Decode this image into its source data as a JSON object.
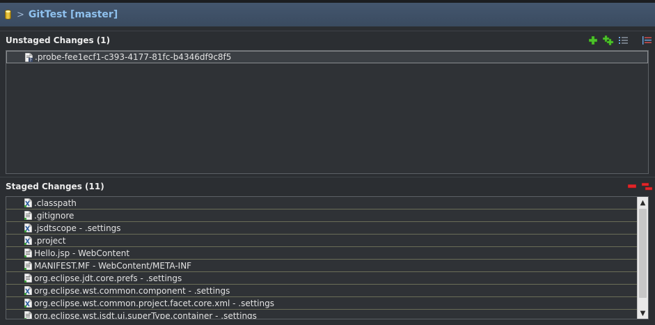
{
  "repo": {
    "title": "GitTest [master]",
    "chevron": ">"
  },
  "unstaged": {
    "title": "Unstaged Changes (1)",
    "toolbar": [
      "add-icon",
      "add-all-icon",
      "tree-view-icon",
      "menu-icon"
    ],
    "items": [
      {
        "label": ".probe-fee1ecf1-c393-4177-81fc-b4346df9c8f5",
        "icon": "untracked-file-icon"
      }
    ]
  },
  "staged": {
    "title": "Staged Changes (11)",
    "toolbar": [
      "remove-icon",
      "remove-all-icon"
    ],
    "items": [
      {
        "label": ".classpath",
        "icon": "xml-file-icon"
      },
      {
        "label": ".gitignore",
        "icon": "text-file-icon"
      },
      {
        "label": ".jsdtscope - .settings",
        "icon": "xml-file-icon"
      },
      {
        "label": ".project",
        "icon": "xml-file-icon"
      },
      {
        "label": "Hello.jsp - WebContent",
        "icon": "text-file-icon"
      },
      {
        "label": "MANIFEST.MF - WebContent/META-INF",
        "icon": "text-file-icon"
      },
      {
        "label": "org.eclipse.jdt.core.prefs - .settings",
        "icon": "text-file-icon"
      },
      {
        "label": "org.eclipse.wst.common.component - .settings",
        "icon": "xml-file-icon"
      },
      {
        "label": "org.eclipse.wst.common.project.facet.core.xml - .settings",
        "icon": "xml-file-icon"
      },
      {
        "label": "org.eclipse.wst.jsdt.ui.superType.container - .settings",
        "icon": "text-file-icon"
      }
    ]
  },
  "colors": {
    "header": "#3d4f64",
    "title": "#8fc1ee",
    "add": "#4cc32a",
    "remove": "#e2262a"
  }
}
